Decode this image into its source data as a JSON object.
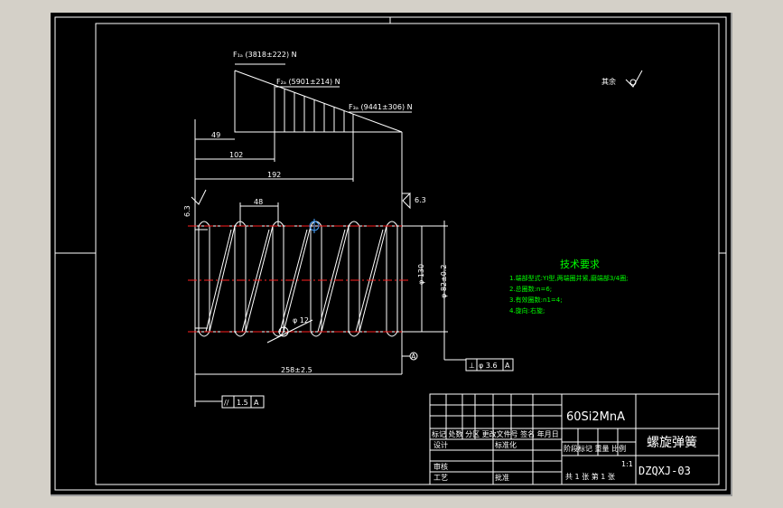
{
  "drawing": {
    "loads": {
      "f1": "F₁ₐ (3818±222) N",
      "f2": "F₂ₐ (5901±214) N",
      "f3": "F₃ₐ (9441±306) N"
    },
    "dims": {
      "d49": "49",
      "d102": "102",
      "d192": "192",
      "d48": "48",
      "d12": "φ 12",
      "free_length": "258±2.5",
      "od": "φ 130",
      "id": "φ 82±0.2",
      "rough_left": "6.3",
      "rough_right": "6.3"
    },
    "other_surface": "其余",
    "datum": "A",
    "perp": {
      "sym": "⊥",
      "value": "φ 3.6",
      "ref": "A"
    },
    "parallel": {
      "sym": "//",
      "value": "1.5",
      "ref": "A"
    }
  },
  "notes": {
    "title": "技术要求",
    "lines": [
      "1.端部型式:YI型,两端圈并紧,磨端部3/4圈;",
      "2.总圈数:n=6;",
      "3.有效圈数:n1=4;",
      "4.旋向:右旋;"
    ]
  },
  "titleblock": {
    "material": "60Si2MnA",
    "name": "螺旋弹簧",
    "code": "DZQXJ-03",
    "header_row": "标记 处数 分区 更改文件号 签名 年月日",
    "design": "设计",
    "standard": "标准化",
    "stage_row": "阶段标记 重量 比例",
    "scale": "1:1",
    "review": "审核",
    "process": "工艺",
    "approve": "批准",
    "sheets": "共 1 张   第 1 张"
  }
}
